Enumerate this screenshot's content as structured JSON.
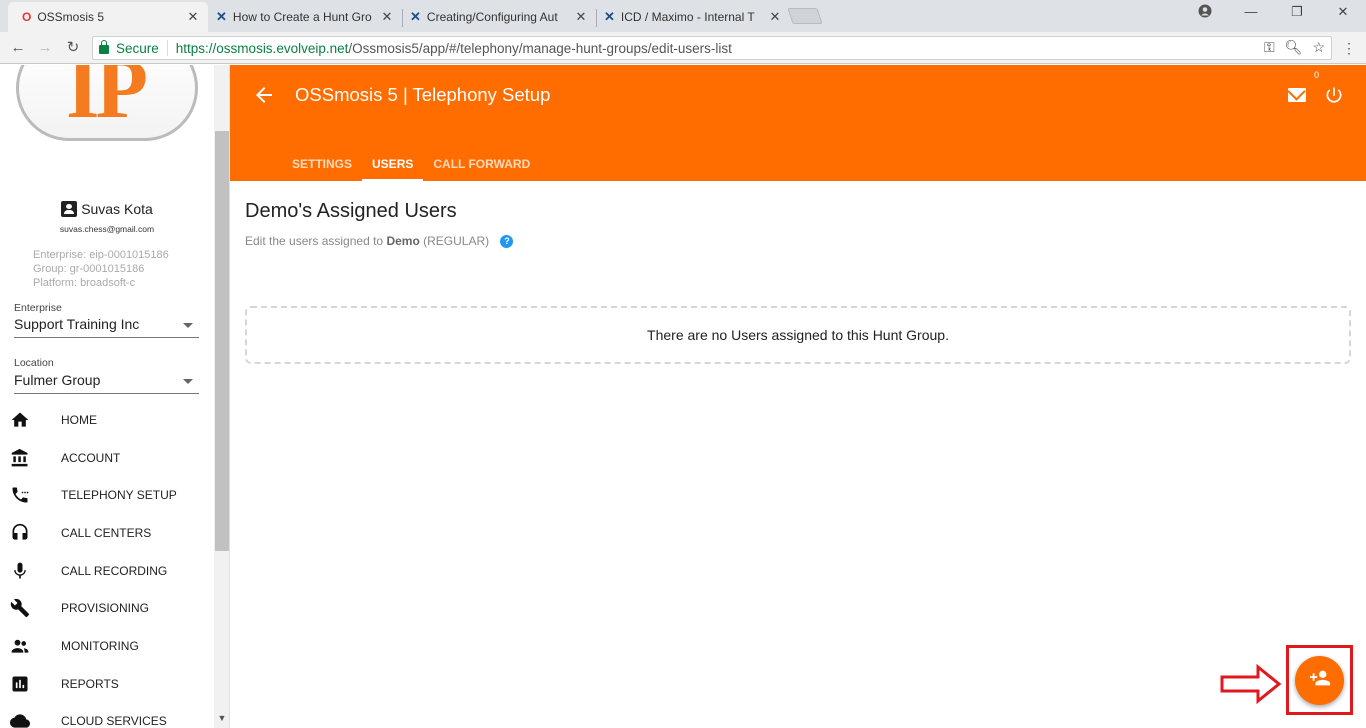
{
  "browser": {
    "tabs": [
      {
        "title": "OSSmosis 5",
        "active": true
      },
      {
        "title": "How to Create a Hunt Gro",
        "active": false
      },
      {
        "title": "Creating/Configuring Aut",
        "active": false
      },
      {
        "title": "ICD / Maximo - Internal T",
        "active": false
      }
    ],
    "secure_label": "Secure",
    "url_host": "https://ossmosis.evolveip.net",
    "url_path": "/Ossmosis5/app/#/telephony/manage-hunt-groups/edit-users-list"
  },
  "sidebar": {
    "logo_text": "IP",
    "user_name": "Suvas Kota",
    "user_email": "suvas.chess@gmail.com",
    "enterprise_meta": "Enterprise: eip-0001015186",
    "group_meta": "Group: gr-0001015186",
    "platform_meta": "Platform: broadsoft-c",
    "enterprise_label": "Enterprise",
    "enterprise_value": "Support Training Inc",
    "location_label": "Location",
    "location_value": "Fulmer Group",
    "nav": [
      {
        "label": "HOME",
        "icon": "home-icon"
      },
      {
        "label": "ACCOUNT",
        "icon": "bank-icon"
      },
      {
        "label": "TELEPHONY SETUP",
        "icon": "phone-icon"
      },
      {
        "label": "CALL CENTERS",
        "icon": "headset-icon"
      },
      {
        "label": "CALL RECORDING",
        "icon": "microphone-icon"
      },
      {
        "label": "PROVISIONING",
        "icon": "wrench-icon"
      },
      {
        "label": "MONITORING",
        "icon": "people-icon"
      },
      {
        "label": "REPORTS",
        "icon": "chart-icon"
      },
      {
        "label": "CLOUD SERVICES",
        "icon": "cloud-icon"
      }
    ]
  },
  "header": {
    "title": "OSSmosis 5 | Telephony Setup",
    "mail_count": "0",
    "tabs": [
      {
        "label": "SETTINGS",
        "active": false
      },
      {
        "label": "USERS",
        "active": true
      },
      {
        "label": "CALL FORWARD",
        "active": false
      }
    ]
  },
  "main": {
    "title": "Demo's Assigned Users",
    "subtitle_prefix": "Edit the users assigned to",
    "subtitle_name": "Demo",
    "subtitle_type": "(REGULAR)",
    "help_glyph": "?",
    "empty_message": "There are no Users assigned to this Hunt Group."
  },
  "colors": {
    "accent": "#ff6d00",
    "annotation": "#e0191f",
    "secure": "#0b8043"
  }
}
